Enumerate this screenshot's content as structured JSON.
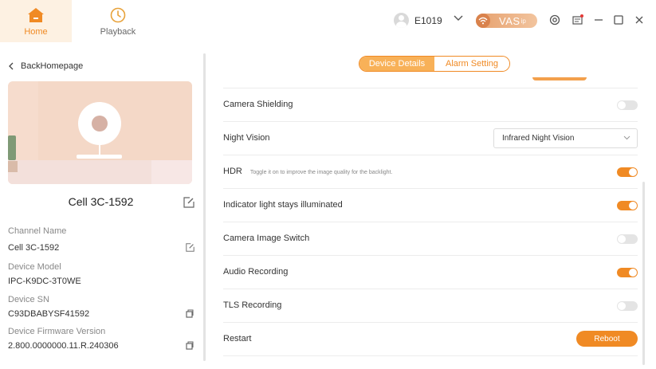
{
  "nav": {
    "home_label": "Home",
    "playback_label": "Playback"
  },
  "user": {
    "name": "E1019"
  },
  "vas": {
    "label": "VAS",
    "sub": "ip"
  },
  "left": {
    "back_label": "BackHomepage",
    "device_name": "Cell 3C-1592",
    "fields": [
      {
        "label": "Channel Name",
        "value": "Cell 3C-1592"
      },
      {
        "label": "Device Model",
        "value": "IPC-K9DC-3T0WE"
      },
      {
        "label": "Device SN",
        "value": "C93DBABYSF41592"
      },
      {
        "label": "Device Firmware Version",
        "value": "2.800.0000000.11.R.240306"
      }
    ]
  },
  "tabs": {
    "device_details": "Device Details",
    "alarm_setting": "Alarm Setting"
  },
  "settings": [
    {
      "label": "Camera Shielding",
      "state": "off"
    },
    {
      "label": "Night Vision",
      "select_value": "Infrared Night Vision"
    },
    {
      "label": "HDR",
      "hint": "Toggle it on to improve the image quality for the backlight.",
      "state": "on"
    },
    {
      "label": "Indicator light stays illuminated",
      "state": "on"
    },
    {
      "label": "Camera Image Switch",
      "state": "off"
    },
    {
      "label": "Audio Recording",
      "state": "on"
    },
    {
      "label": "TLS Recording",
      "state": "off"
    },
    {
      "label": "Restart",
      "button_label": "Reboot"
    }
  ],
  "colors": {
    "accent": "#f08a24",
    "accent_light": "#f8b158",
    "home_bg": "#fdf1e2"
  }
}
